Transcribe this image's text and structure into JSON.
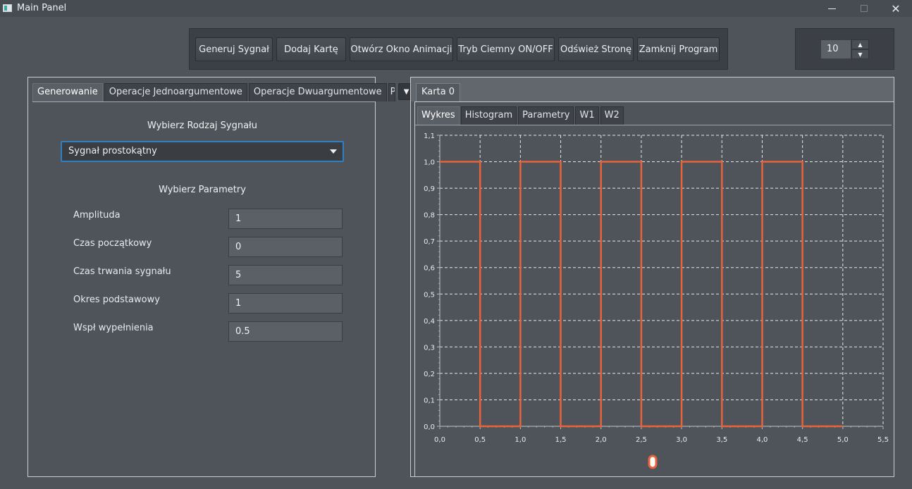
{
  "window": {
    "title": "Main Panel",
    "minimize_glyph": "",
    "maximize_glyph": "",
    "close_glyph": "✕"
  },
  "toolbar": {
    "buttons": [
      {
        "label": "Generuj Sygnał"
      },
      {
        "label": "Dodaj Kartę"
      },
      {
        "label": "Otwórz Okno Animacji"
      },
      {
        "label": "Tryb Ciemny ON/OFF"
      },
      {
        "label": "Odśwież Stronę"
      },
      {
        "label": "Zamknij Program"
      }
    ],
    "spinner_value": "10"
  },
  "left_panel": {
    "tabs": [
      {
        "label": "Generowanie",
        "active": true
      },
      {
        "label": "Operacje Jednoargumentowe",
        "active": false
      },
      {
        "label": "Operacje Dwuargumentowe",
        "active": false
      },
      {
        "label": "P",
        "active": false
      }
    ],
    "signal_type_heading": "Wybierz Rodzaj Sygnału",
    "signal_type_selected": "Sygnał prostokątny",
    "params_heading": "Wybierz Parametry",
    "params": [
      {
        "label": "Amplituda",
        "value": "1"
      },
      {
        "label": "Czas początkowy",
        "value": "0"
      },
      {
        "label": "Czas trwania sygnału",
        "value": "5"
      },
      {
        "label": "Okres podstawowy",
        "value": "1"
      },
      {
        "label": "Wspł wypełnienia",
        "value": "0.5"
      }
    ]
  },
  "right_panel": {
    "card_tab": "Karta 0",
    "tabs": [
      {
        "label": "Wykres",
        "active": true
      },
      {
        "label": "Histogram",
        "active": false
      },
      {
        "label": "Parametry",
        "active": false
      },
      {
        "label": "W1",
        "active": false
      },
      {
        "label": "W2",
        "active": false
      }
    ]
  },
  "colors": {
    "line": "#e8623a",
    "grid": "#e6e6e6",
    "accent": "#2f7fc1"
  },
  "chart_data": {
    "type": "line",
    "title": "",
    "xlabel": "",
    "ylabel": "",
    "xlim": [
      0.0,
      5.5
    ],
    "ylim": [
      0.0,
      1.1
    ],
    "grid": true,
    "x_ticks": [
      "0,0",
      "0,5",
      "1,0",
      "1,5",
      "2,0",
      "2,5",
      "3,0",
      "3,5",
      "4,0",
      "4,5",
      "5,0",
      "5,5"
    ],
    "y_ticks": [
      "0,0",
      "0,1",
      "0,2",
      "0,3",
      "0,4",
      "0,5",
      "0,6",
      "0,7",
      "0,8",
      "0,9",
      "1,0",
      "1,1"
    ],
    "series": [
      {
        "x": [
          0.0,
          0.5,
          0.5,
          1.0,
          1.0,
          1.5,
          1.5,
          2.0,
          2.0,
          2.5,
          2.5,
          3.0,
          3.0,
          3.5,
          3.5,
          4.0,
          4.0,
          4.5,
          4.5,
          5.0
        ],
        "y": [
          1.0,
          1.0,
          0.0,
          0.0,
          1.0,
          1.0,
          0.0,
          0.0,
          1.0,
          1.0,
          0.0,
          0.0,
          1.0,
          1.0,
          0.0,
          0.0,
          1.0,
          1.0,
          0.0,
          0.0
        ]
      }
    ],
    "legend": "bottom-center"
  }
}
